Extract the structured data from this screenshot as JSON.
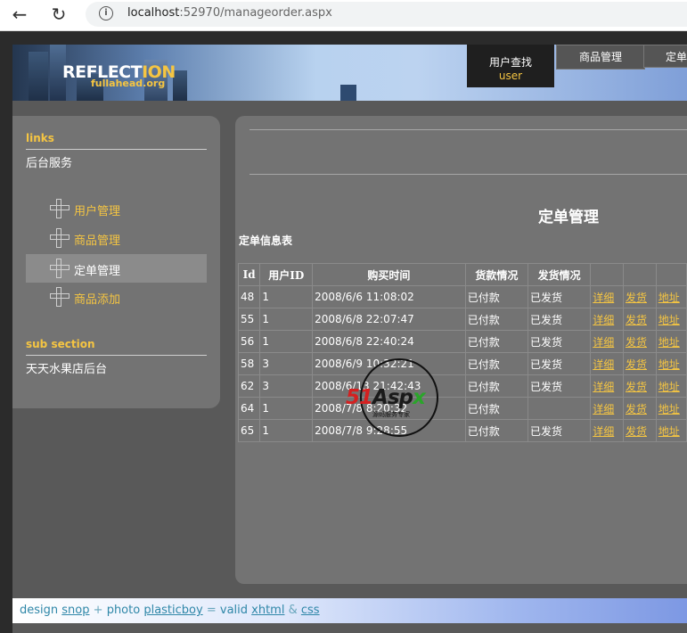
{
  "browser": {
    "url_host": "localhost",
    "url_rest": ":52970/manageorder.aspx"
  },
  "header": {
    "logo_main": "REFLECT",
    "logo_accent": "ION",
    "logo_sub": "fullahead.org",
    "nav_active": {
      "label": "用户查找",
      "sub": "user"
    },
    "nav_tabs": [
      "商品管理",
      "定单"
    ]
  },
  "sidebar": {
    "links_title": "links",
    "links_text": "后台服务",
    "items": [
      {
        "label": "用户管理",
        "active": false
      },
      {
        "label": "商品管理",
        "active": false
      },
      {
        "label": "定单管理",
        "active": true
      },
      {
        "label": "商品添加",
        "active": false
      }
    ],
    "sub_title": "sub section",
    "sub_text": "天天水果店后台"
  },
  "main": {
    "page_title": "定单管理",
    "table_title": "定单信息表",
    "columns": [
      "Id",
      "用户ID",
      "购买时间",
      "货款情况",
      "发货情况",
      "",
      "",
      ""
    ],
    "rows": [
      {
        "id": "48",
        "uid": "1",
        "time": "2008/6/6 11:08:02",
        "pay": "已付款",
        "ship": "已发货"
      },
      {
        "id": "55",
        "uid": "1",
        "time": "2008/6/8 22:07:47",
        "pay": "已付款",
        "ship": "已发货"
      },
      {
        "id": "56",
        "uid": "1",
        "time": "2008/6/8 22:40:24",
        "pay": "已付款",
        "ship": "已发货"
      },
      {
        "id": "58",
        "uid": "3",
        "time": "2008/6/9 10:32:21",
        "pay": "已付款",
        "ship": "已发货"
      },
      {
        "id": "62",
        "uid": "3",
        "time": "2008/6/13 21:42:43",
        "pay": "已付款",
        "ship": "已发货"
      },
      {
        "id": "64",
        "uid": "1",
        "time": "2008/7/8 8:20:32",
        "pay": "已付款",
        "ship": ""
      },
      {
        "id": "65",
        "uid": "1",
        "time": "2008/7/8 9:28:55",
        "pay": "已付款",
        "ship": "已发货"
      }
    ],
    "link_detail": "详细",
    "link_ship": "发货",
    "link_addr": "地址"
  },
  "watermark": {
    "text_red": "51",
    "text_dark": "Asp",
    "text_green": "x",
    "sub": "源码服务专家"
  },
  "footer": {
    "design": "design",
    "design_by": "snop",
    "plus": "+",
    "photo": "photo",
    "photo_by": "plasticboy",
    "equals": "=",
    "valid": "valid",
    "xhtml": "xhtml",
    "amp": "&",
    "css": "css"
  },
  "colors": {
    "accent": "#f5c542",
    "panel": "#737373",
    "page": "#595959"
  }
}
